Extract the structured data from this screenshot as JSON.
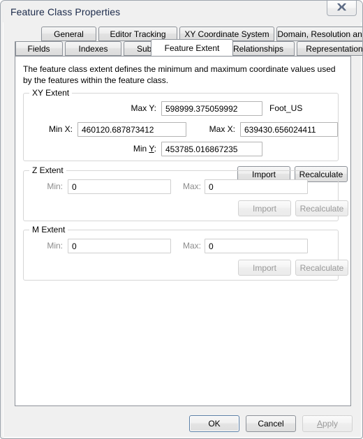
{
  "window": {
    "title": "Feature Class Properties",
    "close_icon": "close-icon",
    "close_glyph": "✖"
  },
  "tabs": {
    "row1": [
      {
        "label": "General",
        "selected": false
      },
      {
        "label": "Editor Tracking",
        "selected": false
      },
      {
        "label": "XY Coordinate System",
        "selected": false
      },
      {
        "label": "Domain, Resolution and Tolerance",
        "selected": false
      }
    ],
    "row2": [
      {
        "label": "Fields",
        "selected": false
      },
      {
        "label": "Indexes",
        "selected": false
      },
      {
        "label": "Subtypes",
        "selected": false
      },
      {
        "label": "Feature Extent",
        "selected": true
      },
      {
        "label": "Relationships",
        "selected": false
      },
      {
        "label": "Representations",
        "selected": false
      }
    ]
  },
  "panel": {
    "description": "The feature class extent defines the minimum and maximum coordinate values used by the features within the feature class.",
    "xy_extent": {
      "group_label": "XY Extent",
      "max_y_label": "Max Y:",
      "max_y_value": "598999.375059992",
      "unit_label": "Foot_US",
      "min_x_label": "Min X:",
      "min_x_value": "460120.687873412",
      "max_x_label": "Max X:",
      "max_x_value": "639430.656024411",
      "min_y_label_prefix": "Min ",
      "min_y_label_accel": "Y",
      "min_y_label_suffix": ":",
      "min_y_value": "453785.016867235",
      "import_label": "Import",
      "recalculate_label": "Recalculate"
    },
    "z_extent": {
      "group_label": "Z Extent",
      "min_label": "Min:",
      "min_value": "0",
      "max_label": "Max:",
      "max_value": "0",
      "import_label": "Import",
      "recalculate_label": "Recalculate"
    },
    "m_extent": {
      "group_label": "M Extent",
      "min_label": "Min:",
      "min_value": "0",
      "max_label": "Max:",
      "max_value": "0",
      "import_label": "Import",
      "recalculate_label": "Recalculate"
    }
  },
  "footer": {
    "ok_label": "OK",
    "cancel_label": "Cancel",
    "apply_label_accel": "A",
    "apply_label_rest": "pply"
  },
  "colors": {
    "dialog_bg": "#f0f0f0",
    "panel_bg": "#ffffff",
    "title_text": "#1b2a4a",
    "border": "#8d9299",
    "group_border": "#d6d6d6",
    "disabled_text": "#8c8c8c",
    "default_button_border": "#5b7fa6"
  }
}
